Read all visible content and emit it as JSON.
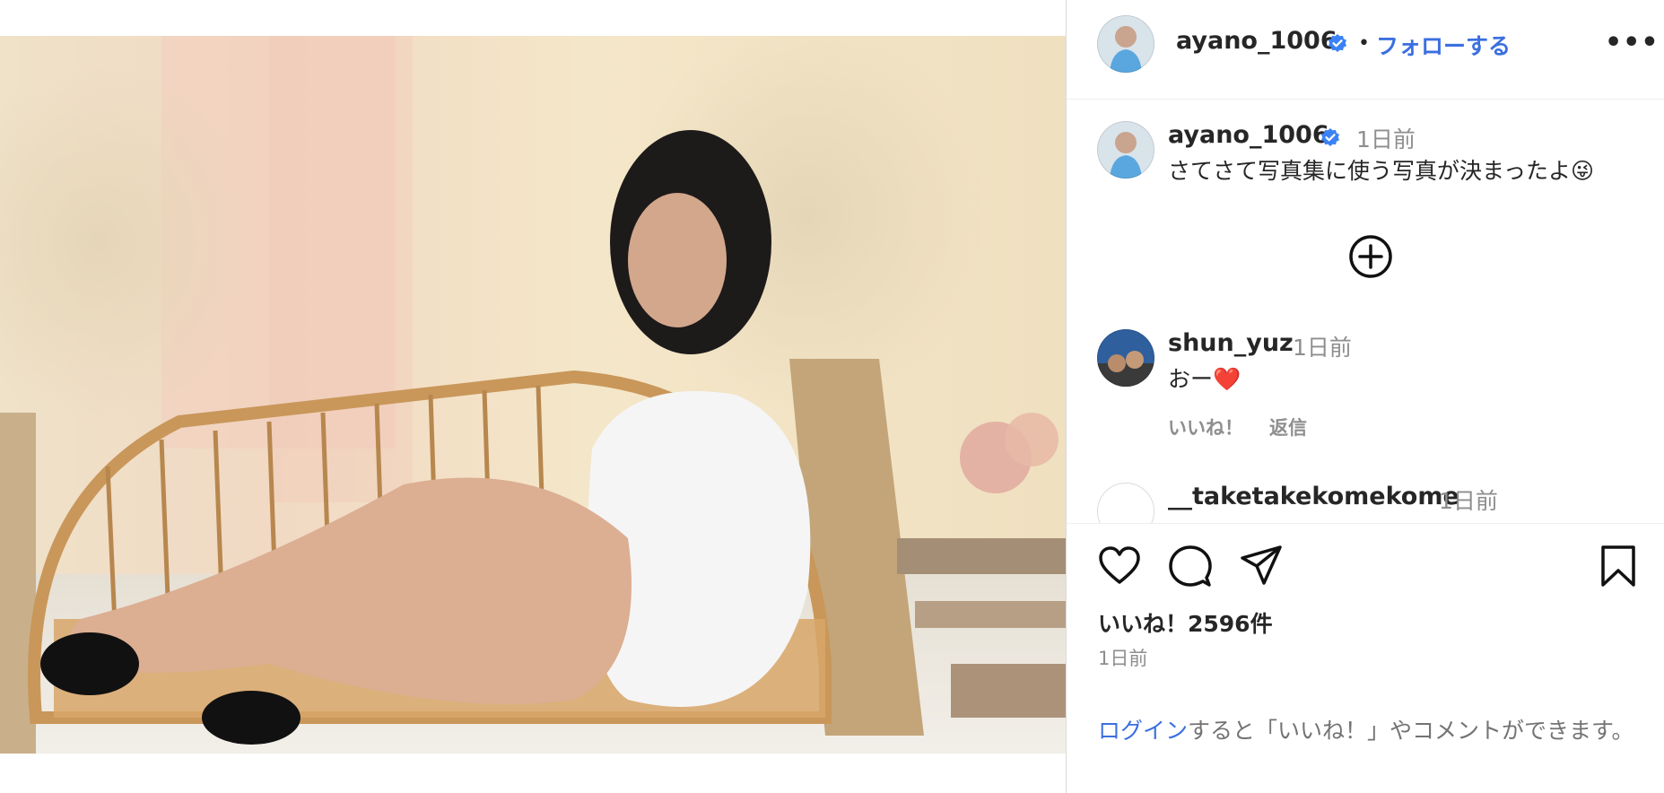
{
  "post": {
    "author": "ayano_1006",
    "follow_label": "フォローする",
    "separator": "•",
    "more_label": "•••",
    "caption_time": "1日前",
    "caption_text": "さてさて写真集に使う写真が決まったよ😜"
  },
  "comments": [
    {
      "user": "shun_yuz",
      "time": "1日前",
      "text": "おー❤️",
      "like_label": "いいね！",
      "reply_label": "返信"
    },
    {
      "user": "__taketakekomekome",
      "time": "1日前",
      "text": ""
    }
  ],
  "actions": {
    "likes_text": "いいね！2596件",
    "posted_ago": "1日前",
    "login_link": "ログイン",
    "login_rest": "すると「いいね！」やコメントができます。"
  },
  "colors": {
    "link": "#3b6fe0",
    "verified": "#3b82f6",
    "muted": "#8e8e8e",
    "heart": "#e0245e"
  },
  "icons": [
    "verified-badge-icon",
    "add-circle-icon",
    "heart-icon",
    "comment-icon",
    "share-icon",
    "bookmark-icon",
    "more-options-icon"
  ]
}
